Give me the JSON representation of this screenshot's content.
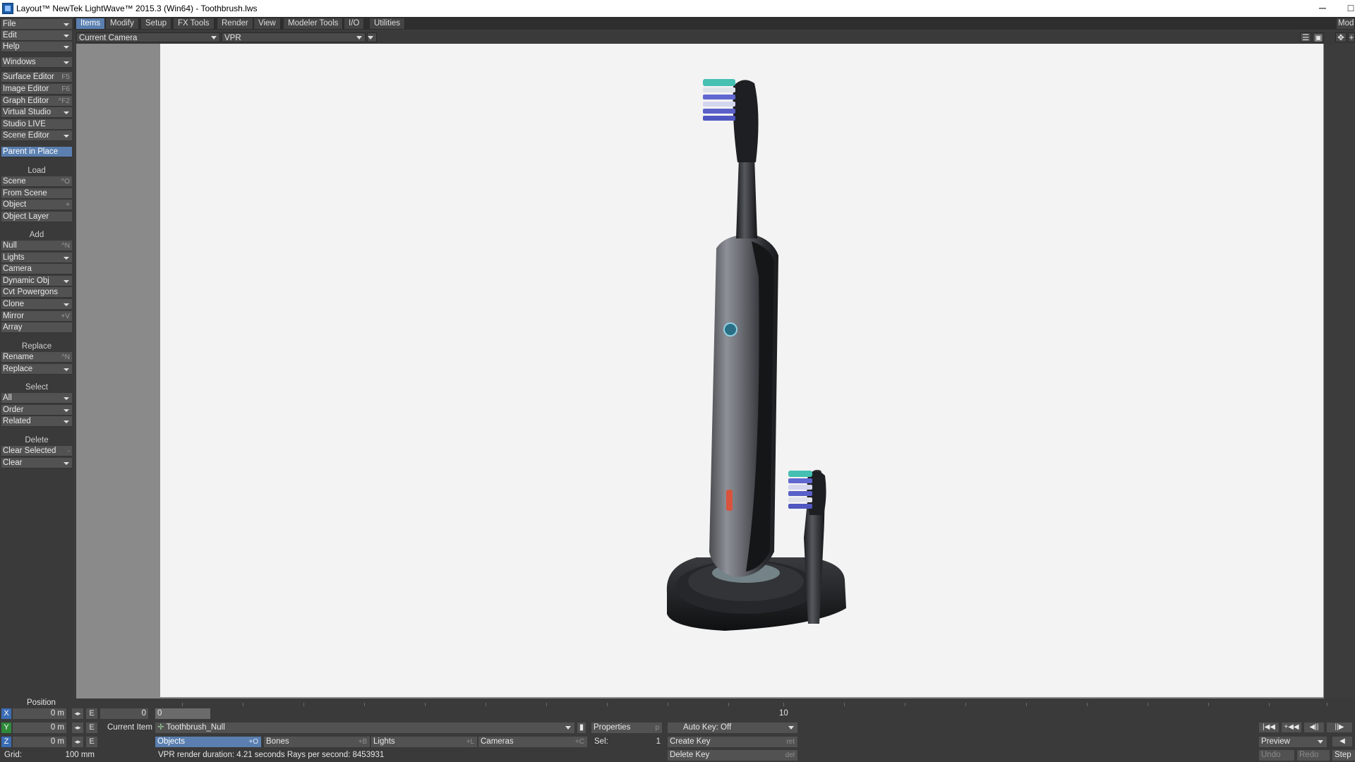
{
  "window": {
    "title": "Layout™ NewTek LightWave™ 2015.3 (Win64) - Toothbrush.lws",
    "minimize": "─",
    "maximize": "□"
  },
  "tabs": [
    "Items",
    "Modify",
    "Setup",
    "FX Tools",
    "Render",
    "View",
    "Modeler Tools",
    "I/O",
    "Utilities"
  ],
  "modeler_tab": "Mod",
  "left_toolbar": {
    "file": "File",
    "edit": "Edit",
    "help": "Help",
    "windows": "Windows",
    "surface_editor": {
      "label": "Surface Editor",
      "shortcut": "F5"
    },
    "image_editor": {
      "label": "Image Editor",
      "shortcut": "F6"
    },
    "graph_editor": {
      "label": "Graph Editor",
      "shortcut": "^F2"
    },
    "virtual_studio": "Virtual Studio",
    "studio_live": "Studio LIVE",
    "scene_editor": "Scene Editor",
    "parent_in_place": "Parent in Place",
    "load_header": "Load",
    "scene": {
      "label": "Scene",
      "shortcut": "^O"
    },
    "from_scene": "From Scene",
    "object": {
      "label": "Object",
      "shortcut": "+"
    },
    "object_layer": "Object Layer",
    "add_header": "Add",
    "null": {
      "label": "Null",
      "shortcut": "^N"
    },
    "lights": "Lights",
    "camera": "Camera",
    "dynamic_obj": "Dynamic Obj",
    "cvt_powergons": "Cvt Powergons",
    "clone": "Clone",
    "mirror": {
      "label": "Mirror",
      "shortcut": "+V"
    },
    "array": "Array",
    "replace_header": "Replace",
    "rename": {
      "label": "Rename",
      "shortcut": "^N"
    },
    "replace": "Replace",
    "select_header": "Select",
    "all": "All",
    "order": "Order",
    "related": "Related",
    "delete_header": "Delete",
    "clear_selected": {
      "label": "Clear Selected",
      "shortcut": "-"
    },
    "clear": "Clear"
  },
  "viewport": {
    "camera_select": "Current Camera",
    "render_mode": "VPR"
  },
  "bottom": {
    "position_label": "Position",
    "x": {
      "axis": "X",
      "value": "0 m"
    },
    "y": {
      "axis": "Y",
      "value": "0 m"
    },
    "z": {
      "axis": "Z",
      "value": "0 m"
    },
    "e_label": "E",
    "frame_value": "0",
    "timeline_marker": "0",
    "timeline_end": "10",
    "current_item_label": "Current Item",
    "current_item": "Toothbrush_Null",
    "properties": {
      "label": "Properties",
      "shortcut": "p"
    },
    "auto_key": "Auto Key: Off",
    "objects": {
      "label": "Objects",
      "shortcut": "+O"
    },
    "bones": {
      "label": "Bones",
      "shortcut": "+B"
    },
    "lights": {
      "label": "Lights",
      "shortcut": "+L"
    },
    "cameras": {
      "label": "Cameras",
      "shortcut": "+C"
    },
    "sel_label": "Sel:",
    "sel_value": "1",
    "create_key": {
      "label": "Create Key",
      "shortcut": "ret"
    },
    "delete_key": {
      "label": "Delete Key",
      "shortcut": "del"
    },
    "grid_label": "Grid:",
    "grid_value": "100 mm",
    "status": "VPR render duration: 4.21 seconds  Rays per second: 8453931",
    "preview": "Preview",
    "undo": "Undo",
    "redo": "Redo",
    "step": "Step"
  }
}
